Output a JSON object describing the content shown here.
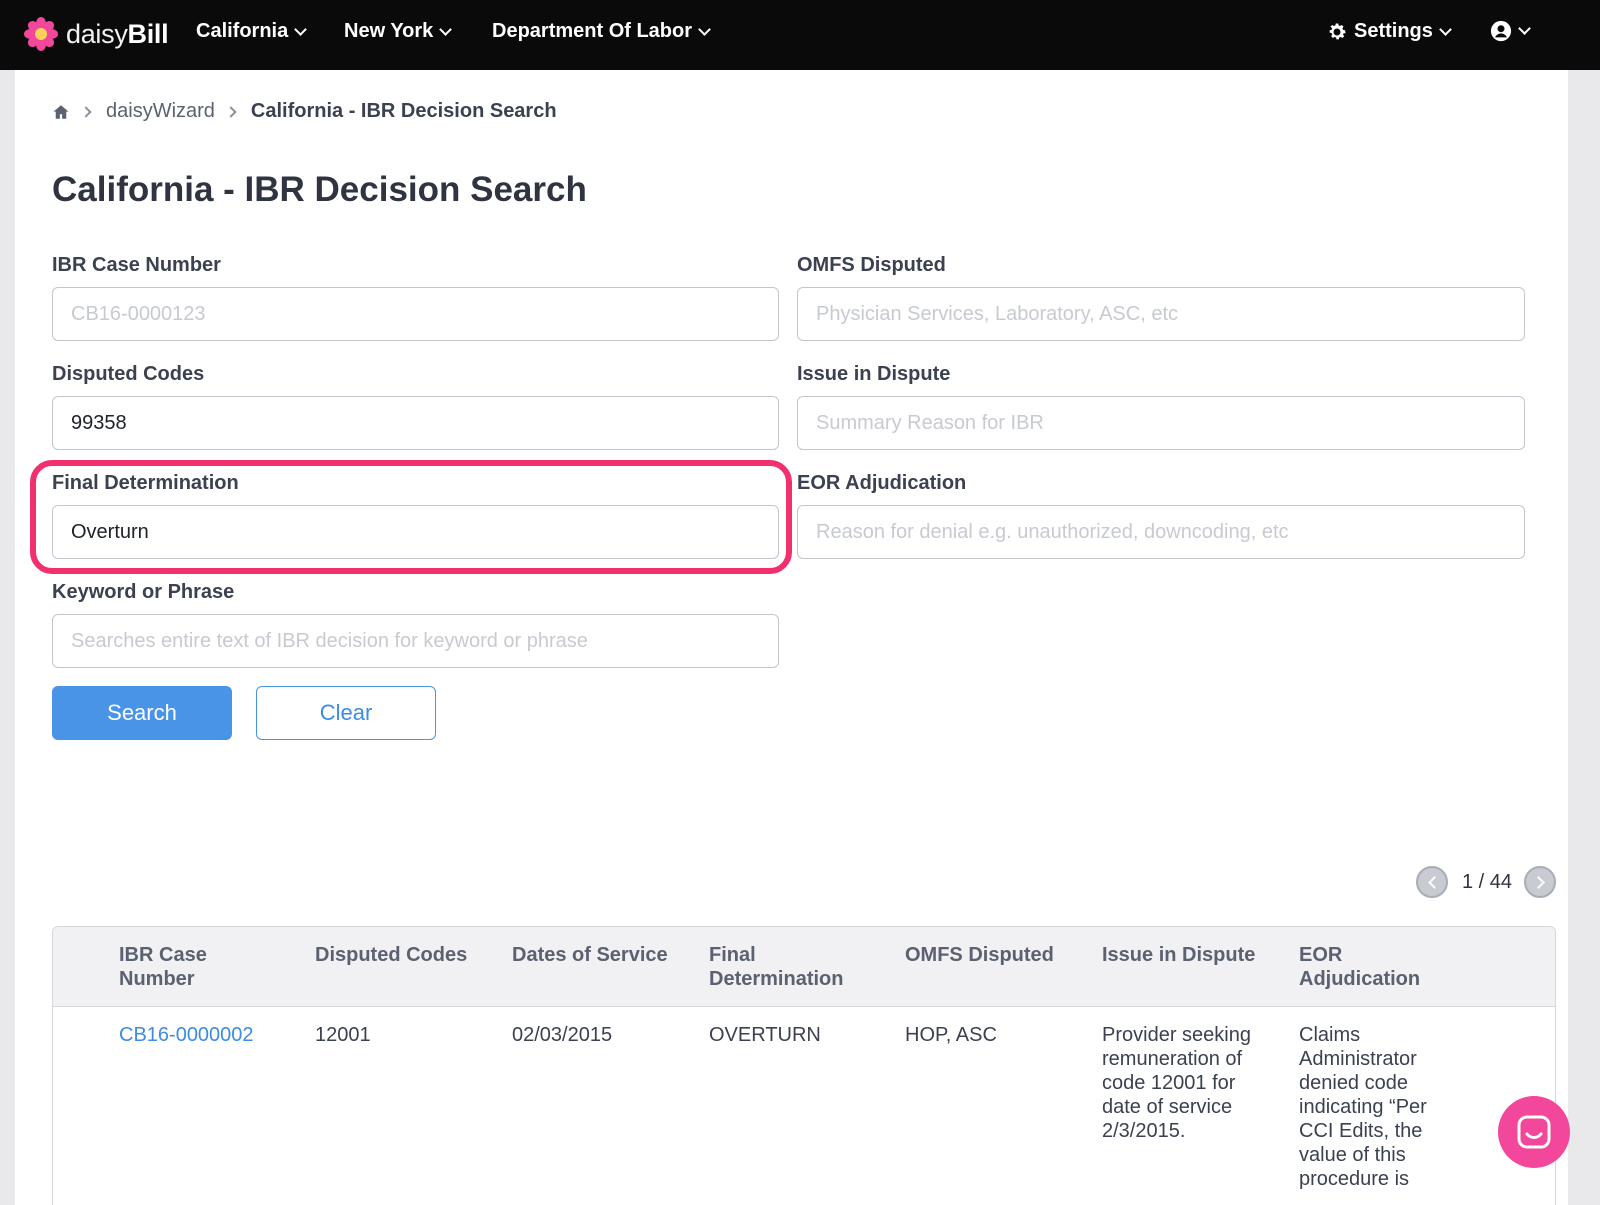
{
  "brand": {
    "name_light": "daisy",
    "name_bold": "Bill"
  },
  "nav": {
    "items": [
      {
        "label": "California"
      },
      {
        "label": "New York"
      },
      {
        "label": "Department Of Labor"
      }
    ],
    "settings_label": "Settings"
  },
  "breadcrumb": {
    "items": [
      "daisyWizard",
      "California - IBR Decision Search"
    ]
  },
  "page_title": "California - IBR Decision Search",
  "form": {
    "ibr_case_number": {
      "label": "IBR Case Number",
      "placeholder": "CB16-0000123",
      "value": ""
    },
    "omfs_disputed": {
      "label": "OMFS Disputed",
      "placeholder": "Physician Services, Laboratory, ASC, etc",
      "value": ""
    },
    "disputed_codes": {
      "label": "Disputed Codes",
      "placeholder": "",
      "value": "99358"
    },
    "issue_in_dispute": {
      "label": "Issue in Dispute",
      "placeholder": "Summary Reason for IBR",
      "value": ""
    },
    "final_determination": {
      "label": "Final Determination",
      "placeholder": "",
      "value": "Overturn"
    },
    "eor_adjudication": {
      "label": "EOR Adjudication",
      "placeholder": "Reason for denial e.g. unauthorized, downcoding, etc",
      "value": ""
    },
    "keyword": {
      "label": "Keyword or Phrase",
      "placeholder": "Searches entire text of IBR decision for keyword or phrase",
      "value": ""
    },
    "search_label": "Search",
    "clear_label": "Clear"
  },
  "pagination": {
    "text": "1 / 44"
  },
  "table": {
    "headers": [
      [
        "IBR Case",
        "Number"
      ],
      [
        "Disputed Codes"
      ],
      [
        "Dates of Service"
      ],
      [
        "Final",
        "Determination"
      ],
      [
        "OMFS Disputed"
      ],
      [
        "Issue in Dispute"
      ],
      [
        "EOR",
        "Adjudication"
      ]
    ],
    "rows": [
      {
        "case_number": "CB16-0000002",
        "disputed_codes": "12001",
        "dates_of_service": "02/03/2015",
        "final_determination": "OVERTURN",
        "omfs_disputed": "HOP, ASC",
        "issue_lines": [
          "Provider seeking",
          "remuneration of",
          "code 12001 for",
          "date of service",
          "2/3/2015."
        ],
        "eor_lines": [
          "Claims",
          "Administrator",
          "denied code",
          "indicating “Per",
          "CCI Edits, the",
          "value of this",
          "procedure is"
        ]
      }
    ]
  },
  "colors": {
    "accent": "#4a94e8",
    "highlight": "#f2306e",
    "navbar": "#0a0a0b",
    "chat": "#f2479a"
  }
}
